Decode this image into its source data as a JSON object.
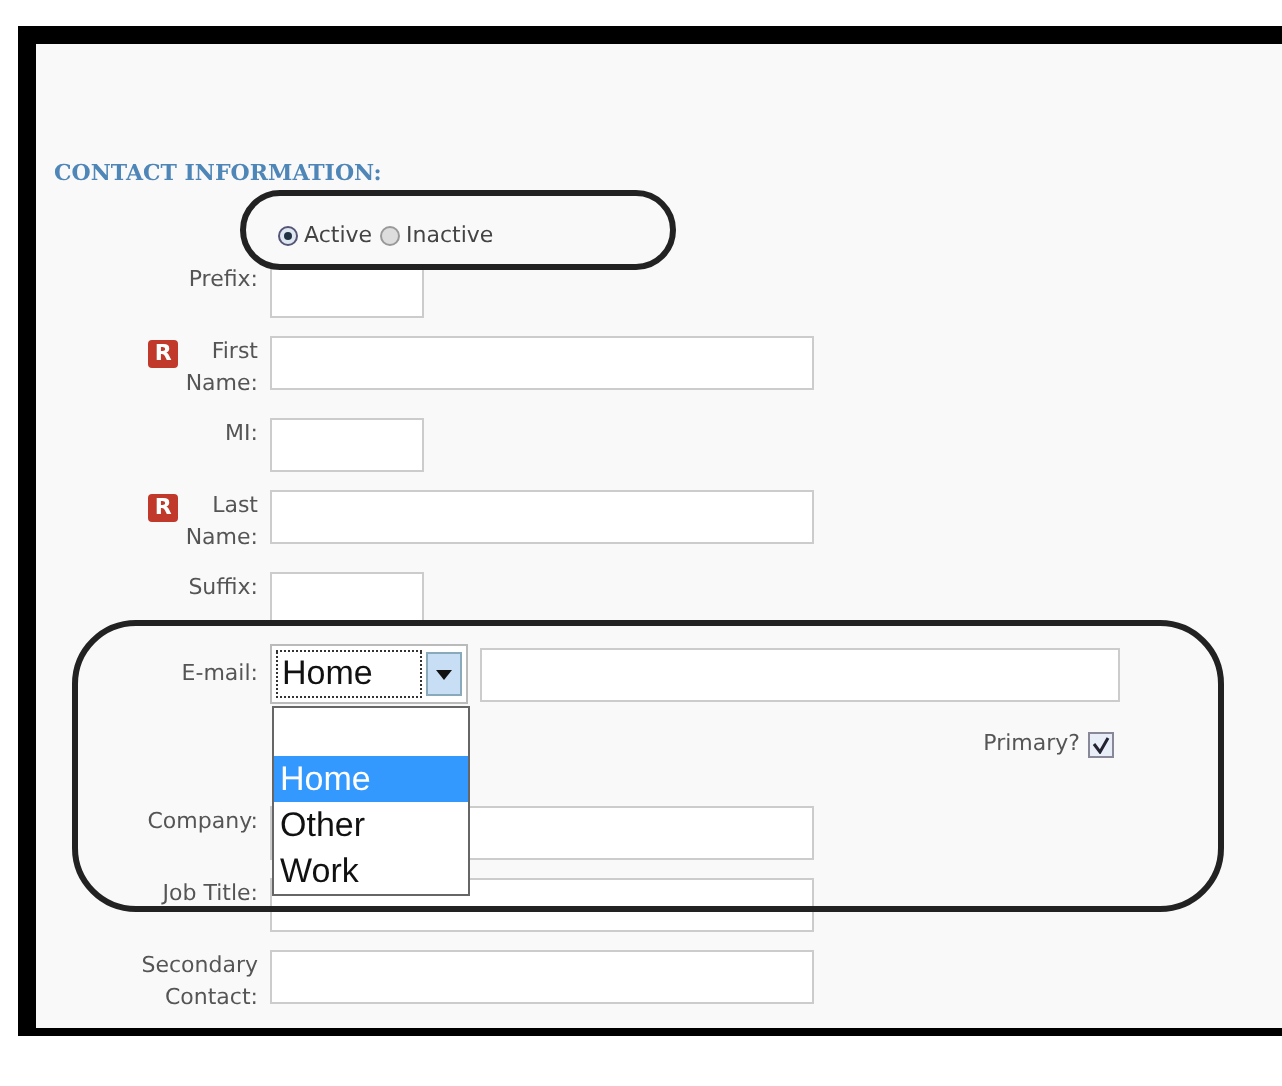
{
  "heading": "CONTACT INFORMATION:",
  "status": [
    {
      "label": "Active",
      "selected": true
    },
    {
      "label": "Inactive",
      "selected": false
    }
  ],
  "fields": [
    {
      "kind": "short",
      "label": "Prefix:"
    },
    {
      "kind": "text",
      "label": "First\nName:",
      "badge": "R"
    },
    {
      "kind": "short",
      "label": "MI:"
    },
    {
      "kind": "text",
      "label": "Last\nName:",
      "badge": "R"
    },
    {
      "kind": "short",
      "label": "Suffix:"
    },
    {
      "kind": "email",
      "label": "E-mail:",
      "type_value": "Home",
      "expanded": true,
      "options": [
        {
          "label": "Home",
          "selected": true
        },
        {
          "label": "Other",
          "selected": false
        },
        {
          "label": "Work",
          "selected": false
        }
      ],
      "primary": {
        "label": "Primary?",
        "checked": true
      }
    },
    {
      "kind": "text",
      "label": "Company:"
    },
    {
      "kind": "text",
      "label": "Job Title:"
    },
    {
      "kind": "text",
      "label": "Secondary\nContact:"
    }
  ]
}
